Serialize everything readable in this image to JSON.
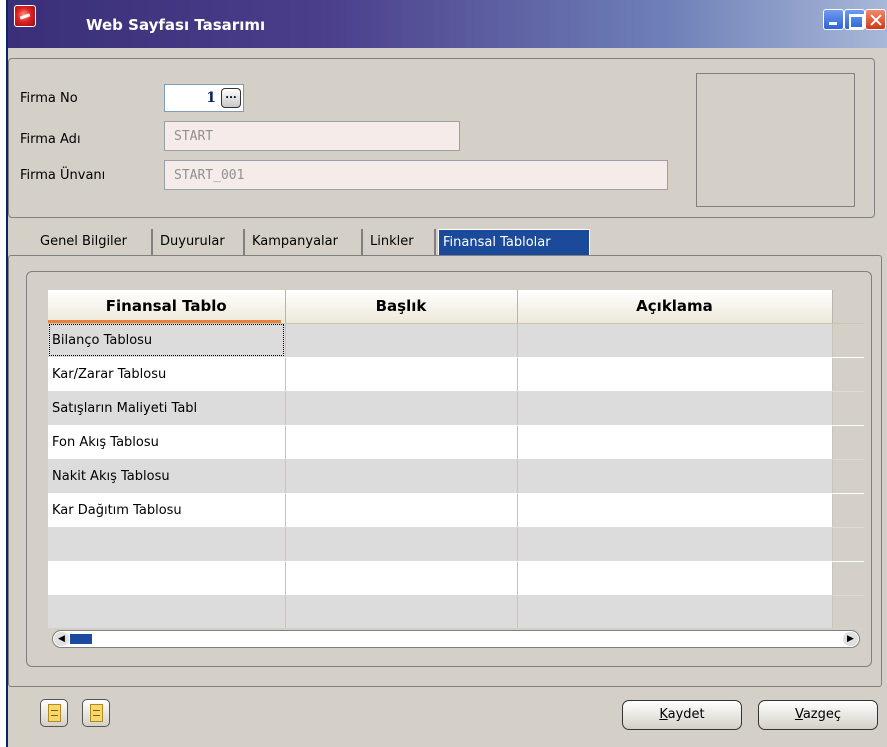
{
  "window": {
    "title": "Web Sayfası Tasarımı"
  },
  "form": {
    "firma_no_label": "Firma No",
    "firma_no_value": "1",
    "firma_no_button": "...",
    "firma_adi_label": "Firma Adı",
    "firma_adi_value": "START",
    "firma_unvani_label": "Firma Ünvanı",
    "firma_unvani_value": "START_001"
  },
  "tabs": [
    {
      "label": "Genel Bilgiler"
    },
    {
      "label": "Duyurular"
    },
    {
      "label": "Kampanyalar"
    },
    {
      "label": "Linkler"
    },
    {
      "label": "Finansal Tablolar"
    }
  ],
  "grid": {
    "columns": [
      "Finansal Tablo",
      "Başlık",
      "Açıklama"
    ],
    "rows": [
      {
        "tablo": "Bilanço Tablosu",
        "baslik": "",
        "aciklama": ""
      },
      {
        "tablo": "Kar/Zarar Tablosu",
        "baslik": "",
        "aciklama": ""
      },
      {
        "tablo": "Satışların Maliyeti Tabl",
        "baslik": "",
        "aciklama": ""
      },
      {
        "tablo": "Fon Akış Tablosu",
        "baslik": "",
        "aciklama": ""
      },
      {
        "tablo": "Nakit Akış Tablosu",
        "baslik": "",
        "aciklama": ""
      },
      {
        "tablo": "Kar Dağıtım Tablosu",
        "baslik": "",
        "aciklama": ""
      },
      {
        "tablo": "",
        "baslik": "",
        "aciklama": ""
      },
      {
        "tablo": "",
        "baslik": "",
        "aciklama": ""
      },
      {
        "tablo": "",
        "baslik": "",
        "aciklama": ""
      }
    ]
  },
  "buttons": {
    "save_mnemonic": "K",
    "save_rest": "aydet",
    "cancel_mnemonic": "V",
    "cancel_rest": "azgeç"
  }
}
